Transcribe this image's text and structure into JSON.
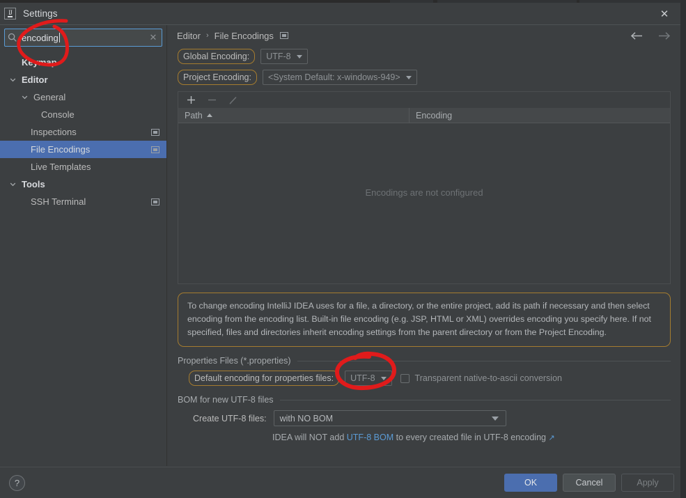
{
  "window": {
    "title": "Settings",
    "logo_text": "IJ",
    "close_label": "✕"
  },
  "sidebar": {
    "search": {
      "value": "encoding",
      "placeholder": "",
      "search_icon": "search-icon",
      "clear_icon": "clear-icon"
    },
    "items": [
      {
        "label": "Keymap",
        "indent": 0,
        "arrow": "",
        "bold": true,
        "selected": false,
        "project_icon": false
      },
      {
        "label": "Editor",
        "indent": 0,
        "arrow": "down",
        "bold": true,
        "selected": false,
        "project_icon": false
      },
      {
        "label": "General",
        "indent": 1,
        "arrow": "down",
        "bold": false,
        "selected": false,
        "project_icon": false
      },
      {
        "label": "Console",
        "indent": 2,
        "arrow": "",
        "bold": false,
        "selected": false,
        "project_icon": false
      },
      {
        "label": "Inspections",
        "indent": 1,
        "arrow": "",
        "bold": false,
        "selected": false,
        "project_icon": true
      },
      {
        "label": "File Encodings",
        "indent": 1,
        "arrow": "",
        "bold": false,
        "selected": true,
        "project_icon": true
      },
      {
        "label": "Live Templates",
        "indent": 1,
        "arrow": "",
        "bold": false,
        "selected": false,
        "project_icon": false
      },
      {
        "label": "Tools",
        "indent": 0,
        "arrow": "down",
        "bold": true,
        "selected": false,
        "project_icon": false
      },
      {
        "label": "SSH Terminal",
        "indent": 1,
        "arrow": "",
        "bold": false,
        "selected": false,
        "project_icon": true
      }
    ]
  },
  "main": {
    "breadcrumb": {
      "root": "Editor",
      "separator": "›",
      "current": "File Encodings",
      "project_icon": "project-scope-icon"
    },
    "nav": {
      "back_icon": "arrow-left-icon",
      "forward_icon": "arrow-right-icon"
    },
    "global_encoding": {
      "label": "Global Encoding:",
      "value": "UTF-8",
      "highlighted": true
    },
    "project_encoding": {
      "label": "Project Encoding:",
      "value": "<System Default: x-windows-949>",
      "highlighted": true
    },
    "table": {
      "toolbar": {
        "add": "+",
        "remove": "−",
        "edit": "pencil-icon"
      },
      "columns": [
        "Path",
        "Encoding"
      ],
      "sort_column": "Path",
      "sort_direction": "asc",
      "rows": [],
      "empty_text": "Encodings are not configured"
    },
    "info_text": "To change encoding IntelliJ IDEA uses for a file, a directory, or the entire project, add its path if necessary and then select encoding from the encoding list. Built-in file encoding (e.g. JSP, HTML or XML) overrides encoding you specify here. If not specified, files and directories inherit encoding settings from the parent directory or from the Project Encoding.",
    "properties_section": {
      "title": "Properties Files (*.properties)",
      "default_encoding_label": "Default encoding for properties files:",
      "default_encoding_value": "UTF-8",
      "transparent_checkbox_label": "Transparent native-to-ascii conversion",
      "transparent_checkbox_checked": false
    },
    "bom_section": {
      "title": "BOM for new UTF-8 files",
      "create_label": "Create UTF-8 files:",
      "create_value": "with NO BOM",
      "note_prefix": "IDEA will NOT add ",
      "note_link": "UTF-8 BOM",
      "note_suffix": " to every created file in UTF-8 encoding",
      "external_link_icon": "↗"
    }
  },
  "footer": {
    "help_label": "?",
    "ok_label": "OK",
    "cancel_label": "Cancel",
    "apply_label": "Apply"
  },
  "annotations": {
    "color": "#e01b1b",
    "marks": [
      "circle-around-search-field",
      "circle-around-properties-encoding-combo"
    ]
  },
  "colors": {
    "background": "#3c3f41",
    "selection": "#4b6eaf",
    "highlight_border": "#a57c2f",
    "link": "#5b9bd5",
    "annotation_red": "#e01b1b"
  }
}
